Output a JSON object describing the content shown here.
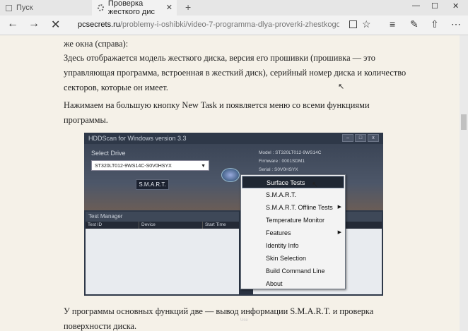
{
  "tabs": [
    {
      "label": "Пуск"
    },
    {
      "label": "Проверка жесткого дис"
    }
  ],
  "toolbar": {
    "url_host": "pcsecrets.ru",
    "url_path": "/problemy-i-oshibki/video-7-programma-dlya-proverki-zhestkogo-diska-h"
  },
  "article": {
    "p0": "же окна (справа):",
    "p1": "Здесь отображается модель жесткого диска, версия его прошивки (прошивка — это управляющая программа, встроенная в жесткий диск), серийный номер диска и количество секторов, которые он имеет.",
    "p2": "Нажимаем на большую кнопку New Task и появляется меню со всеми функциями программы.",
    "p3": "У программы основных функций две — вывод информации S.M.A.R.T. и проверка поверхности диска."
  },
  "hdd": {
    "title": "HDDScan for Windows version 3.3",
    "select_label": "Select Drive",
    "drive_value": "ST320LT012-9WS14C-S0V0HSYX",
    "smart_button": "S.M.A.R.T.",
    "info": [
      "Model : ST320LT012-9WS14C",
      "Firmware : 0001SDM1",
      "Serial : S0V0HSYX"
    ],
    "test_manager_title": "Test Manager",
    "columns": [
      "Test ID",
      "Device",
      "Start Time"
    ],
    "side_label": "Use"
  },
  "menu": {
    "items": [
      {
        "label": "Surface Tests",
        "highlighted": true,
        "submenu": false
      },
      {
        "label": "S.M.A.R.T.",
        "highlighted": false,
        "submenu": false
      },
      {
        "label": "S.M.A.R.T. Offline Tests",
        "highlighted": false,
        "submenu": true
      },
      {
        "label": "Temperature Monitor",
        "highlighted": false,
        "submenu": false
      },
      {
        "label": "Features",
        "highlighted": false,
        "submenu": true
      },
      {
        "label": "Identity Info",
        "highlighted": false,
        "submenu": false
      },
      {
        "label": "Skin Selection",
        "highlighted": false,
        "submenu": false
      },
      {
        "label": "Build Command Line",
        "highlighted": false,
        "submenu": false
      },
      {
        "label": "About",
        "highlighted": false,
        "submenu": false
      }
    ]
  },
  "colors": {
    "page_bg": "#f5f1e8",
    "hdd_bg": "#2e3848",
    "menu_highlight": "#1f2733"
  }
}
